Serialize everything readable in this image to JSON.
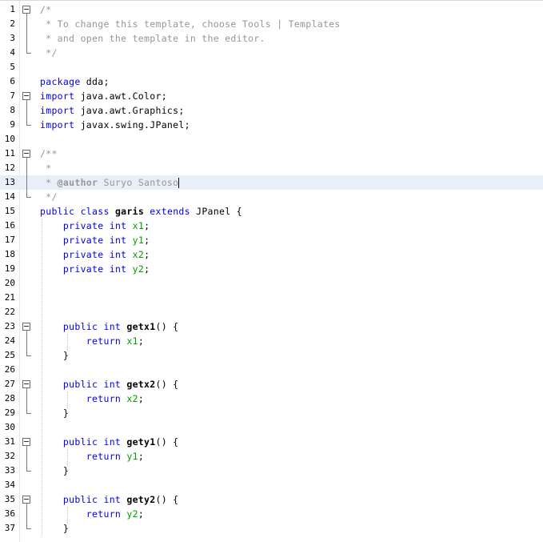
{
  "editor": {
    "lines": [
      {
        "num": "1",
        "tokens": [
          {
            "t": "/*",
            "c": "comment"
          }
        ]
      },
      {
        "num": "2",
        "tokens": [
          {
            "t": " * To change this template, choose Tools | Templates",
            "c": "comment"
          }
        ]
      },
      {
        "num": "3",
        "tokens": [
          {
            "t": " * and open the template in the editor.",
            "c": "comment"
          }
        ]
      },
      {
        "num": "4",
        "tokens": [
          {
            "t": " */",
            "c": "comment"
          }
        ]
      },
      {
        "num": "5",
        "tokens": []
      },
      {
        "num": "6",
        "tokens": [
          {
            "t": "package",
            "c": "kw"
          },
          {
            "t": " dda;",
            "c": ""
          }
        ]
      },
      {
        "num": "7",
        "tokens": [
          {
            "t": "import",
            "c": "kw"
          },
          {
            "t": " java.awt.Color;",
            "c": ""
          }
        ]
      },
      {
        "num": "8",
        "tokens": [
          {
            "t": "import",
            "c": "kw"
          },
          {
            "t": " java.awt.Graphics;",
            "c": ""
          }
        ]
      },
      {
        "num": "9",
        "tokens": [
          {
            "t": "import",
            "c": "kw"
          },
          {
            "t": " javax.swing.JPanel;",
            "c": ""
          }
        ]
      },
      {
        "num": "10",
        "tokens": []
      },
      {
        "num": "11",
        "tokens": [
          {
            "t": "/**",
            "c": "comment"
          }
        ]
      },
      {
        "num": "12",
        "tokens": [
          {
            "t": " *",
            "c": "comment"
          }
        ]
      },
      {
        "num": "13",
        "tokens": [
          {
            "t": " * ",
            "c": "comment"
          },
          {
            "t": "@author",
            "c": "comment bold"
          },
          {
            "t": " Suryo Santoso",
            "c": "comment"
          }
        ],
        "current": true,
        "caret": true
      },
      {
        "num": "14",
        "tokens": [
          {
            "t": " */",
            "c": "comment"
          }
        ]
      },
      {
        "num": "15",
        "tokens": [
          {
            "t": "public",
            "c": "kw"
          },
          {
            "t": " ",
            "c": ""
          },
          {
            "t": "class",
            "c": "kw"
          },
          {
            "t": " ",
            "c": ""
          },
          {
            "t": "garis",
            "c": "bold"
          },
          {
            "t": " ",
            "c": ""
          },
          {
            "t": "extends",
            "c": "kw"
          },
          {
            "t": " JPanel {",
            "c": ""
          }
        ]
      },
      {
        "num": "16",
        "tokens": [
          {
            "t": "    ",
            "c": ""
          },
          {
            "t": "private",
            "c": "kw"
          },
          {
            "t": " ",
            "c": ""
          },
          {
            "t": "int",
            "c": "kw"
          },
          {
            "t": " ",
            "c": ""
          },
          {
            "t": "x1",
            "c": "field"
          },
          {
            "t": ";",
            "c": ""
          }
        ]
      },
      {
        "num": "17",
        "tokens": [
          {
            "t": "    ",
            "c": ""
          },
          {
            "t": "private",
            "c": "kw"
          },
          {
            "t": " ",
            "c": ""
          },
          {
            "t": "int",
            "c": "kw"
          },
          {
            "t": " ",
            "c": ""
          },
          {
            "t": "y1",
            "c": "field"
          },
          {
            "t": ";",
            "c": ""
          }
        ]
      },
      {
        "num": "18",
        "tokens": [
          {
            "t": "    ",
            "c": ""
          },
          {
            "t": "private",
            "c": "kw"
          },
          {
            "t": " ",
            "c": ""
          },
          {
            "t": "int",
            "c": "kw"
          },
          {
            "t": " ",
            "c": ""
          },
          {
            "t": "x2",
            "c": "field"
          },
          {
            "t": ";",
            "c": ""
          }
        ]
      },
      {
        "num": "19",
        "tokens": [
          {
            "t": "    ",
            "c": ""
          },
          {
            "t": "private",
            "c": "kw"
          },
          {
            "t": " ",
            "c": ""
          },
          {
            "t": "int",
            "c": "kw"
          },
          {
            "t": " ",
            "c": ""
          },
          {
            "t": "y2",
            "c": "field"
          },
          {
            "t": ";",
            "c": ""
          }
        ]
      },
      {
        "num": "20",
        "tokens": []
      },
      {
        "num": "21",
        "tokens": []
      },
      {
        "num": "22",
        "tokens": []
      },
      {
        "num": "23",
        "tokens": [
          {
            "t": "    ",
            "c": ""
          },
          {
            "t": "public",
            "c": "kw"
          },
          {
            "t": " ",
            "c": ""
          },
          {
            "t": "int",
            "c": "kw"
          },
          {
            "t": " ",
            "c": ""
          },
          {
            "t": "getx1",
            "c": "bold"
          },
          {
            "t": "() {",
            "c": ""
          }
        ]
      },
      {
        "num": "24",
        "tokens": [
          {
            "t": "        ",
            "c": ""
          },
          {
            "t": "return",
            "c": "kw"
          },
          {
            "t": " ",
            "c": ""
          },
          {
            "t": "x1",
            "c": "field"
          },
          {
            "t": ";",
            "c": ""
          }
        ]
      },
      {
        "num": "25",
        "tokens": [
          {
            "t": "    }",
            "c": ""
          }
        ]
      },
      {
        "num": "26",
        "tokens": []
      },
      {
        "num": "27",
        "tokens": [
          {
            "t": "    ",
            "c": ""
          },
          {
            "t": "public",
            "c": "kw"
          },
          {
            "t": " ",
            "c": ""
          },
          {
            "t": "int",
            "c": "kw"
          },
          {
            "t": " ",
            "c": ""
          },
          {
            "t": "getx2",
            "c": "bold"
          },
          {
            "t": "() {",
            "c": ""
          }
        ]
      },
      {
        "num": "28",
        "tokens": [
          {
            "t": "        ",
            "c": ""
          },
          {
            "t": "return",
            "c": "kw"
          },
          {
            "t": " ",
            "c": ""
          },
          {
            "t": "x2",
            "c": "field"
          },
          {
            "t": ";",
            "c": ""
          }
        ]
      },
      {
        "num": "29",
        "tokens": [
          {
            "t": "    }",
            "c": ""
          }
        ]
      },
      {
        "num": "30",
        "tokens": []
      },
      {
        "num": "31",
        "tokens": [
          {
            "t": "    ",
            "c": ""
          },
          {
            "t": "public",
            "c": "kw"
          },
          {
            "t": " ",
            "c": ""
          },
          {
            "t": "int",
            "c": "kw"
          },
          {
            "t": " ",
            "c": ""
          },
          {
            "t": "gety1",
            "c": "bold"
          },
          {
            "t": "() {",
            "c": ""
          }
        ]
      },
      {
        "num": "32",
        "tokens": [
          {
            "t": "        ",
            "c": ""
          },
          {
            "t": "return",
            "c": "kw"
          },
          {
            "t": " ",
            "c": ""
          },
          {
            "t": "y1",
            "c": "field"
          },
          {
            "t": ";",
            "c": ""
          }
        ]
      },
      {
        "num": "33",
        "tokens": [
          {
            "t": "    }",
            "c": ""
          }
        ]
      },
      {
        "num": "34",
        "tokens": []
      },
      {
        "num": "35",
        "tokens": [
          {
            "t": "    ",
            "c": ""
          },
          {
            "t": "public",
            "c": "kw"
          },
          {
            "t": " ",
            "c": ""
          },
          {
            "t": "int",
            "c": "kw"
          },
          {
            "t": " ",
            "c": ""
          },
          {
            "t": "gety2",
            "c": "bold"
          },
          {
            "t": "() {",
            "c": ""
          }
        ]
      },
      {
        "num": "36",
        "tokens": [
          {
            "t": "        ",
            "c": ""
          },
          {
            "t": "return",
            "c": "kw"
          },
          {
            "t": " ",
            "c": ""
          },
          {
            "t": "y2",
            "c": "field"
          },
          {
            "t": ";",
            "c": ""
          }
        ]
      },
      {
        "num": "37",
        "tokens": [
          {
            "t": "    }",
            "c": ""
          }
        ]
      }
    ]
  },
  "colors": {
    "keyword": "#0000e6",
    "comment": "#969696",
    "field": "#009900",
    "current_line": "#e9eff8"
  }
}
